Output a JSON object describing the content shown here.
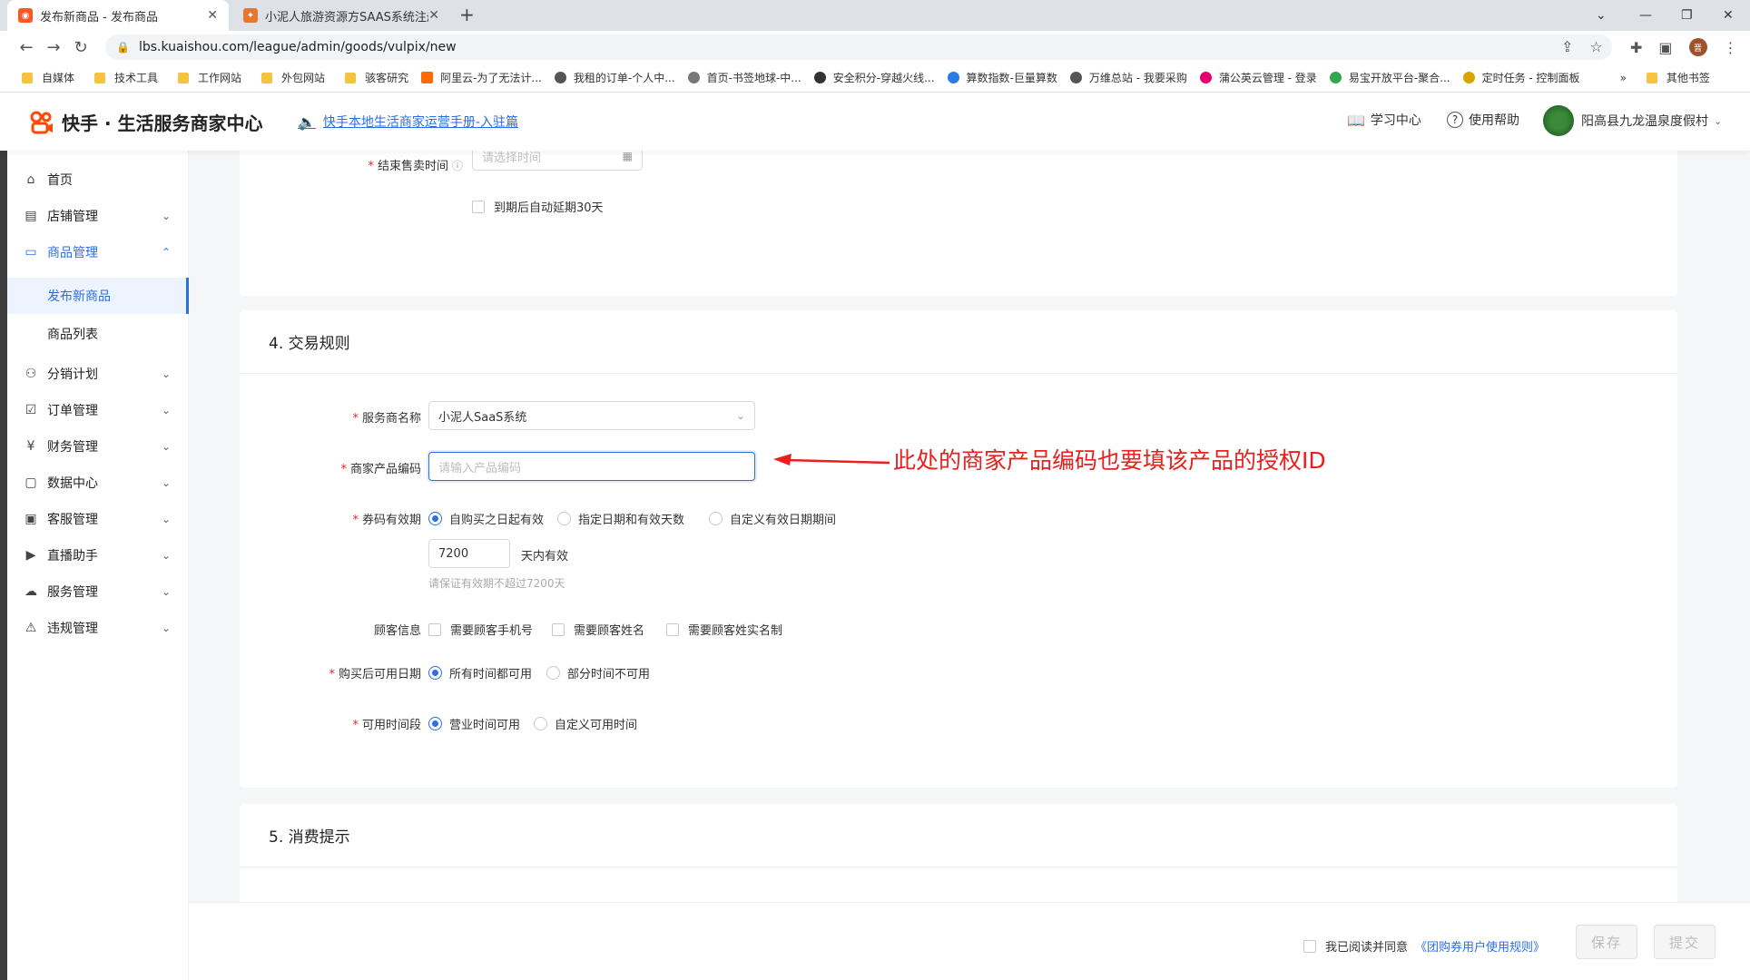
{
  "browser": {
    "tabs": [
      {
        "title": "发布新商品 - 发布商品",
        "active": true
      },
      {
        "title": "小泥人旅游资源方SAAS系统注册",
        "active": false
      }
    ],
    "url": "lbs.kuaishou.com/league/admin/goods/vulpix/new",
    "profile_initial": "晋",
    "bookmarks": [
      "自媒体",
      "技术工具",
      "工作网站",
      "外包网站",
      "骇客研究",
      "阿里云-为了无法计...",
      "我租的订单-个人中...",
      "首页-书签地球-中...",
      "安全积分-穿越火线...",
      "算数指数-巨量算数",
      "万维总站 - 我要采购",
      "蒲公英云管理 - 登录",
      "易宝开放平台-聚合...",
      "定时任务 - 控制面板"
    ],
    "bookmarks_more": "»",
    "other_bookmarks": "其他书签"
  },
  "header": {
    "brand": "快手 · 生活服务商家中心",
    "notice": "快手本地生活商家运营手册-入驻篇",
    "learning_center": "学习中心",
    "help": "使用帮助",
    "merchant_name": "阳高县九龙温泉度假村"
  },
  "sidebar": {
    "items": [
      {
        "label": "首页",
        "icon": "home-icon"
      },
      {
        "label": "店铺管理",
        "icon": "store-icon"
      },
      {
        "label": "商品管理",
        "icon": "goods-icon"
      },
      {
        "label": "分销计划",
        "icon": "distribution-icon"
      },
      {
        "label": "订单管理",
        "icon": "order-icon"
      },
      {
        "label": "财务管理",
        "icon": "finance-icon"
      },
      {
        "label": "数据中心",
        "icon": "data-icon"
      },
      {
        "label": "客服管理",
        "icon": "service-icon"
      },
      {
        "label": "直播助手",
        "icon": "live-icon"
      },
      {
        "label": "服务管理",
        "icon": "service-mgmt-icon"
      },
      {
        "label": "违规管理",
        "icon": "violation-icon"
      }
    ],
    "sub_items": [
      "发布新商品",
      "商品列表"
    ]
  },
  "section_top": {
    "end_time_label": "结束售卖时间",
    "end_time_placeholder": "请选择时间",
    "auto_extend": "到期后自动延期30天"
  },
  "section4": {
    "title": "4. 交易规则",
    "provider_label": "服务商名称",
    "provider_value": "小泥人SaaS系统",
    "product_code_label": "商家产品编码",
    "product_code_placeholder": "请输入产品编码",
    "validity_label": "券码有效期",
    "validity_options": [
      "自购买之日起有效",
      "指定日期和有效天数",
      "自定义有效日期期间"
    ],
    "validity_days": "7200",
    "validity_days_suffix": "天内有效",
    "validity_hint": "请保证有效期不超过7200天",
    "customer_info_label": "顾客信息",
    "customer_info_options": [
      "需要顾客手机号",
      "需要顾客姓名",
      "需要顾客姓实名制"
    ],
    "usable_date_label": "购买后可用日期",
    "usable_date_options": [
      "所有时间都可用",
      "部分时间不可用"
    ],
    "usable_time_label": "可用时间段",
    "usable_time_options": [
      "营业时间可用",
      "自定义可用时间"
    ]
  },
  "section5": {
    "title": "5. 消费提示"
  },
  "annotation": "此处的商家产品编码也要填该产品的授权ID",
  "footer": {
    "agree_text": "我已阅读并同意",
    "agree_link": "《团购券用户使用规则》",
    "save": "保存",
    "submit": "提交"
  },
  "colors": {
    "accent": "#2b6ee6",
    "annotation": "#e8201e",
    "required": "#f5222d"
  }
}
